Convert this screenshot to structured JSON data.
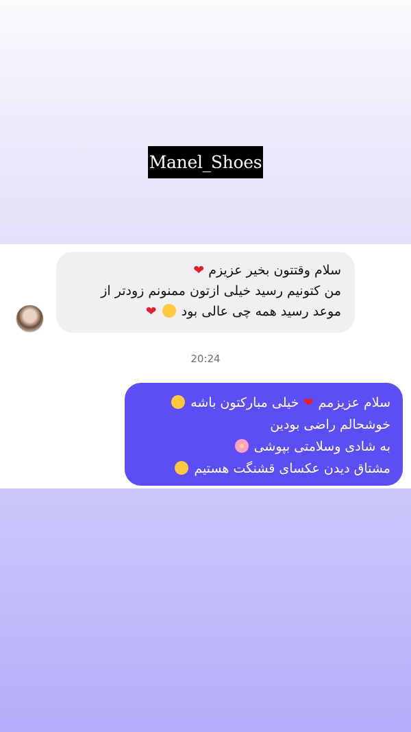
{
  "brand": {
    "tag": "Manel_Shoes"
  },
  "chat": {
    "incoming": {
      "avatar_alt": "",
      "line1": "سلام وقتتون بخیر عزیزم",
      "line2": "من کتونیم رسید خیلی ازتون ممنونم  زودتر از",
      "line3": "موعد  رسید همه چی عالی بود",
      "emoji_heart": "❤️",
      "emoji_pleading": "🥹"
    },
    "timestamp": "20:24",
    "outgoing": {
      "line1_a": "سلام عزیزمم",
      "line1_b": "خیلی مبارکتون باشه",
      "line2": "خوشحالم راضی بودین",
      "line3": "به شادی وسلامتی بپوشی",
      "line4": "مشتاق دیدن عکسای قشنگت هستیم",
      "emoji_heart": "❤️",
      "emoji_heart_eyes": "😍",
      "emoji_blossom": "🌸",
      "emoji_smiling_hearts": "🥰"
    }
  },
  "colors": {
    "outgoing_bubble": "#5b4ef5",
    "incoming_bubble": "#f0f0f2",
    "brand_tag_bg": "#000000"
  }
}
